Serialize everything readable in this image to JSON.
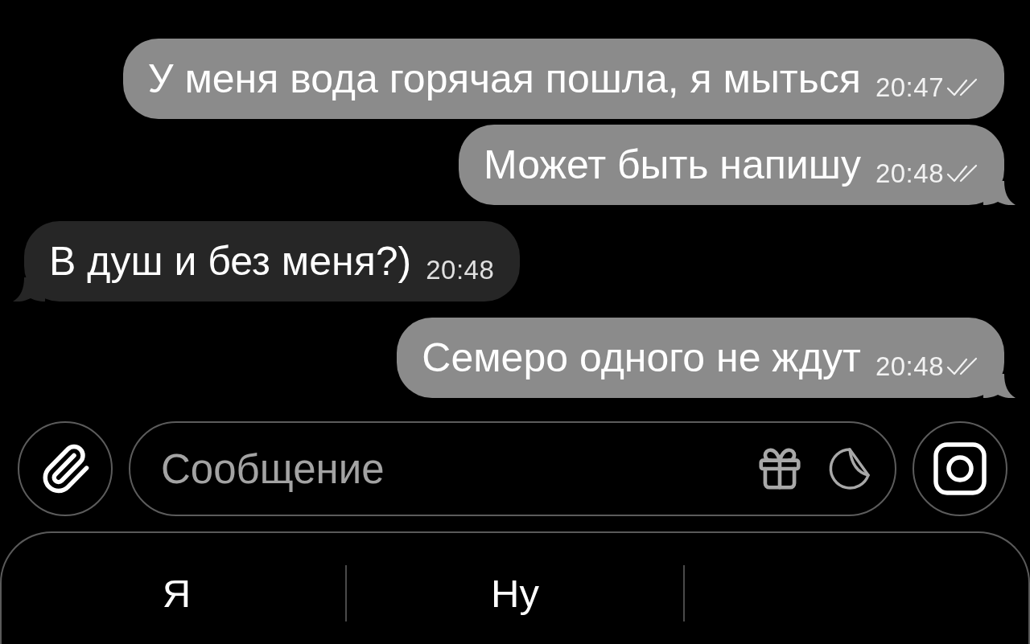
{
  "messages": [
    {
      "kind": "outgoing",
      "text": "У меня вода горячая пошла, я мыться",
      "time": "20:47",
      "read": true,
      "tail": false
    },
    {
      "kind": "outgoing",
      "text": "Может быть напишу",
      "time": "20:48",
      "read": true,
      "tail": true
    },
    {
      "kind": "incoming",
      "text": "В душ и без меня?)",
      "time": "20:48",
      "tail": true
    },
    {
      "kind": "outgoing",
      "text": "Семеро одного не ждут",
      "time": "20:48",
      "read": true,
      "tail": true
    }
  ],
  "composer": {
    "placeholder": "Сообщение"
  },
  "suggestions": [
    {
      "label": "Я"
    },
    {
      "label": "Ну"
    }
  ]
}
